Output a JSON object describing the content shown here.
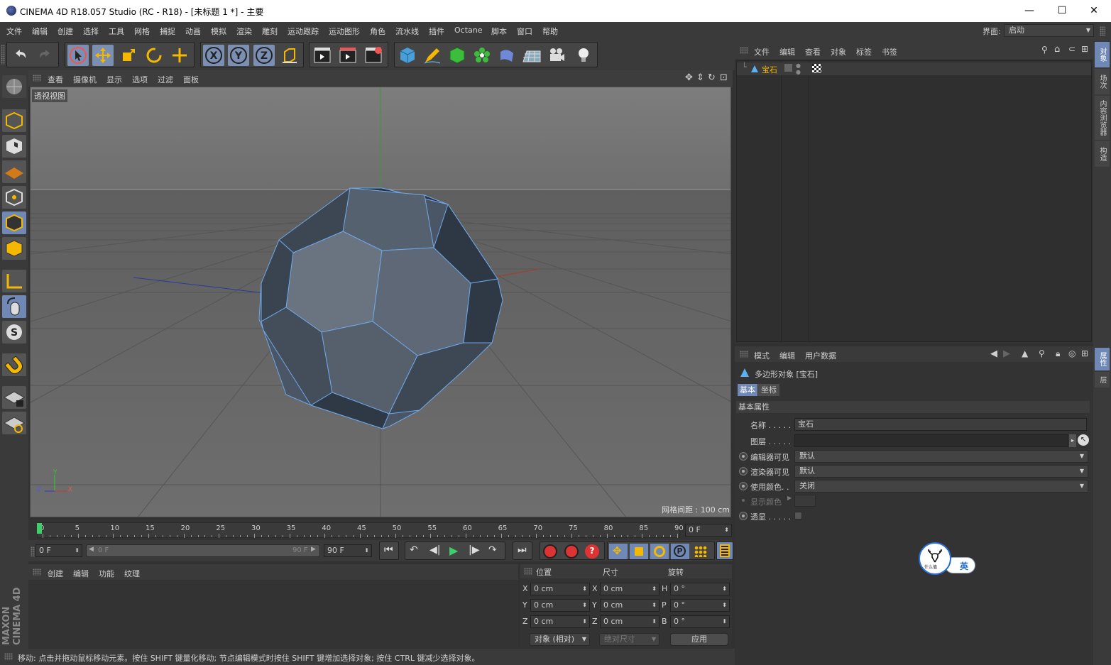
{
  "window": {
    "title": "CINEMA 4D R18.057 Studio (RC - R18) - [未标题 1 *] - 主要",
    "minimize": "—",
    "maximize": "☐",
    "close": "✕"
  },
  "menu": [
    "文件",
    "编辑",
    "创建",
    "选择",
    "工具",
    "网格",
    "捕捉",
    "动画",
    "模拟",
    "渲染",
    "雕刻",
    "运动跟踪",
    "运动图形",
    "角色",
    "流水线",
    "插件",
    "Octane",
    "脚本",
    "窗口",
    "帮助"
  ],
  "layout": {
    "label": "界面:",
    "value": "启动"
  },
  "viewport": {
    "menu": [
      "查看",
      "摄像机",
      "显示",
      "选项",
      "过滤",
      "面板"
    ],
    "view_name": "透视视图",
    "grid_spacing": "网格间距 : 100 cm",
    "axes": {
      "y": "Y",
      "z": "Z",
      "x": "X"
    }
  },
  "timeline": {
    "ticks": [
      "0",
      "5",
      "10",
      "15",
      "20",
      "25",
      "30",
      "35",
      "40",
      "45",
      "50",
      "55",
      "60",
      "65",
      "70",
      "75",
      "80",
      "85",
      "90"
    ],
    "current_frame": "0 F"
  },
  "transport": {
    "start": "0 F",
    "range_start": "0 F",
    "range_end": "90 F",
    "end": "90 F"
  },
  "material_manager": {
    "menu": [
      "创建",
      "编辑",
      "功能",
      "纹理"
    ]
  },
  "coordinates": {
    "headers": [
      "位置",
      "尺寸",
      "旋转"
    ],
    "rows": [
      {
        "a": "X",
        "pos": "0 cm",
        "b": "X",
        "size": "0 cm",
        "c": "H",
        "rot": "0 °"
      },
      {
        "a": "Y",
        "pos": "0 cm",
        "b": "Y",
        "size": "0 cm",
        "c": "P",
        "rot": "0 °"
      },
      {
        "a": "Z",
        "pos": "0 cm",
        "b": "Z",
        "size": "0 cm",
        "c": "B",
        "rot": "0 °"
      }
    ],
    "mode": "对象 (相对)",
    "size_mode": "绝对尺寸",
    "apply": "应用"
  },
  "status": "移动: 点击并拖动鼠标移动元素。按住 SHIFT 键量化移动; 节点编辑模式时按住 SHIFT 键增加选择对象; 按住 CTRL 键减少选择对象。",
  "object_manager": {
    "menu": [
      "文件",
      "编辑",
      "查看",
      "对象",
      "标签",
      "书签"
    ],
    "object": "宝石"
  },
  "right_tabs_top": [
    "对象",
    "场次",
    "内容浏览器",
    "构造"
  ],
  "right_tabs_bottom": [
    "属性",
    "层"
  ],
  "attributes": {
    "menu": [
      "模式",
      "编辑",
      "用户数据"
    ],
    "object_title": "多边形对象 [宝石]",
    "tabs": [
      "基本",
      "坐标"
    ],
    "section": "基本属性",
    "fields": {
      "name_label": "名称 . . . . .",
      "name_value": "宝石",
      "layer_label": "图层 . . . . .",
      "editor_vis_label": "编辑器可见",
      "editor_vis_value": "默认",
      "render_vis_label": "渲染器可见",
      "render_vis_value": "默认",
      "use_color_label": "使用颜色. .",
      "use_color_value": "关闭",
      "display_color_label": "显示颜色",
      "xray_label": "透显 . . . . ."
    }
  },
  "ime": {
    "lang": "英",
    "badge": "什么值"
  },
  "maxon": "MAXON CINEMA 4D"
}
